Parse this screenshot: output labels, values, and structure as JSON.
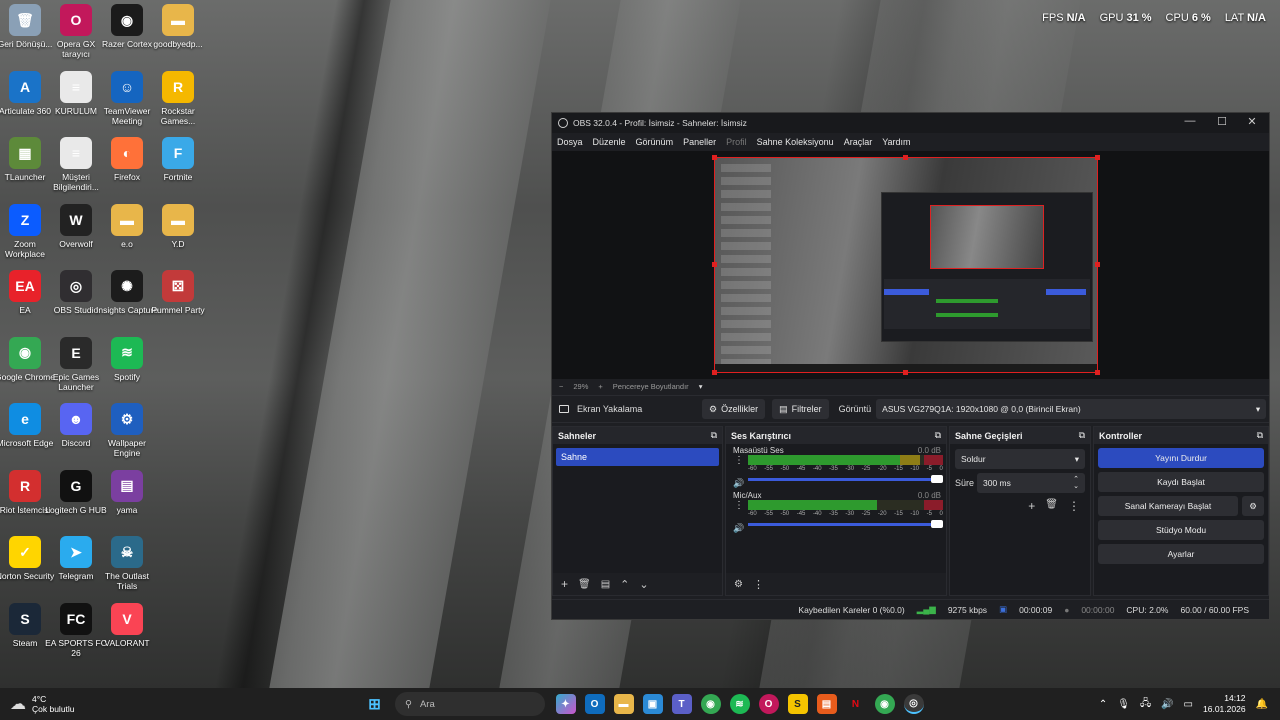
{
  "perf": {
    "fps_label": "FPS",
    "fps_value": "N/A",
    "gpu_label": "GPU",
    "gpu_value": "31 %",
    "cpu_label": "CPU",
    "cpu_value": "6 %",
    "lat_label": "LAT",
    "lat_value": "N/A"
  },
  "desktop_icons": [
    {
      "label": "Geri Dönüşü...",
      "color": "#8aa0b6",
      "glyph": "🗑"
    },
    {
      "label": "Opera GX tarayıcı",
      "color": "#c2185b",
      "glyph": "O"
    },
    {
      "label": "Razer Cortex",
      "color": "#1b1b1b",
      "glyph": "◉"
    },
    {
      "label": "goodbyedp...",
      "color": "#e8b64a",
      "glyph": "▬"
    },
    {
      "label": "Articulate 360",
      "color": "#1a73c8",
      "glyph": "A"
    },
    {
      "label": "KURULUM",
      "color": "#e9e9e9",
      "glyph": "≡"
    },
    {
      "label": "TeamViewer Meeting",
      "color": "#1565c0",
      "glyph": "☺"
    },
    {
      "label": "Rockstar Games...",
      "color": "#f5b800",
      "glyph": "R"
    },
    {
      "label": "TLauncher",
      "color": "#5d8a3a",
      "glyph": "▦"
    },
    {
      "label": "Müşteri Bilgilendiri...",
      "color": "#e9e9e9",
      "glyph": "≡"
    },
    {
      "label": "Firefox",
      "color": "#ff7139",
      "glyph": "◐"
    },
    {
      "label": "Fortnite",
      "color": "#3aa9e8",
      "glyph": "F"
    },
    {
      "label": "Zoom Workplace",
      "color": "#0b5cff",
      "glyph": "Z"
    },
    {
      "label": "Overwolf",
      "color": "#222222",
      "glyph": "W"
    },
    {
      "label": "e.o",
      "color": "#e8b64a",
      "glyph": "▬"
    },
    {
      "label": "Y.D",
      "color": "#e8b64a",
      "glyph": "▬"
    },
    {
      "label": "EA",
      "color": "#e8222a",
      "glyph": "EA"
    },
    {
      "label": "OBS Studio",
      "color": "#302e31",
      "glyph": "◎"
    },
    {
      "label": "Insights Capture",
      "color": "#1c1c1c",
      "glyph": "✺"
    },
    {
      "label": "Pummel Party",
      "color": "#c23a3a",
      "glyph": "⚄"
    },
    {
      "label": "Google Chrome",
      "color": "#34a853",
      "glyph": "◉"
    },
    {
      "label": "Epic Games Launcher",
      "color": "#2a2a2a",
      "glyph": "E"
    },
    {
      "label": "Spotify",
      "color": "#1db954",
      "glyph": "≋"
    },
    {
      "label": "",
      "color": "transparent",
      "glyph": ""
    },
    {
      "label": "Microsoft Edge",
      "color": "#0f8de2",
      "glyph": "e"
    },
    {
      "label": "Discord",
      "color": "#5865f2",
      "glyph": "☻"
    },
    {
      "label": "Wallpaper Engine",
      "color": "#1f5fbf",
      "glyph": "⚙"
    },
    {
      "label": "",
      "color": "transparent",
      "glyph": ""
    },
    {
      "label": "Riot İstemcisi",
      "color": "#d32f2f",
      "glyph": "R"
    },
    {
      "label": "Logitech G HUB",
      "color": "#111111",
      "glyph": "G"
    },
    {
      "label": "yama",
      "color": "#7b3fa0",
      "glyph": "▤"
    },
    {
      "label": "",
      "color": "transparent",
      "glyph": ""
    },
    {
      "label": "Norton Security",
      "color": "#ffd500",
      "glyph": "✓"
    },
    {
      "label": "Telegram",
      "color": "#2aabee",
      "glyph": "➤"
    },
    {
      "label": "The Outlast Trials",
      "color": "#2b6a8a",
      "glyph": "☠"
    },
    {
      "label": "",
      "color": "transparent",
      "glyph": ""
    },
    {
      "label": "Steam",
      "color": "#1b2838",
      "glyph": "S"
    },
    {
      "label": "EA SPORTS FC 26",
      "color": "#111111",
      "glyph": "FC"
    },
    {
      "label": "VALORANT",
      "color": "#fa4454",
      "glyph": "V"
    },
    {
      "label": "",
      "color": "transparent",
      "glyph": ""
    }
  ],
  "obs": {
    "window_title": "OBS 32.0.4 - Profil: İsimsiz - Sahneler: İsimsiz",
    "menu": [
      "Dosya",
      "Düzenle",
      "Görünüm",
      "Paneller",
      "Profil",
      "Sahne Koleksiyonu",
      "Araçlar",
      "Yardım"
    ],
    "zoom": {
      "minus": "−",
      "value": "29%",
      "plus": "+",
      "fit": "Pencereye Boyutlandır"
    },
    "source_bar": {
      "source_name": "Ekran Yakalama",
      "properties": "Özellikler",
      "filters": "Filtreler",
      "display_label": "Görüntü",
      "display_value": "ASUS VG279Q1A: 1920x1080 @ 0,0 (Birincil Ekran)"
    },
    "scenes": {
      "title": "Sahneler",
      "items": [
        "Sahne"
      ]
    },
    "mixer": {
      "title": "Ses Karıştırıcı",
      "scale": [
        "-60",
        "-55",
        "-50",
        "-45",
        "-40",
        "-35",
        "-30",
        "-25",
        "-20",
        "-15",
        "-10",
        "-5",
        "0"
      ],
      "channels": [
        {
          "name": "Masaüstü Ses",
          "db": "0.0 dB",
          "level": 0.88
        },
        {
          "name": "Mic/Aux",
          "db": "0.0 dB",
          "level": 0.66
        }
      ]
    },
    "transitions": {
      "title": "Sahne Geçişleri",
      "type": "Soldur",
      "duration_label": "Süre",
      "duration_value": "300 ms"
    },
    "controls": {
      "title": "Kontroller",
      "buttons": [
        "Yayını Durdur",
        "Kaydı Başlat",
        "Sanal Kamerayı Başlat",
        "Stüdyo Modu",
        "Ayarlar"
      ]
    },
    "status": {
      "dropped": "Kaybedilen Kareler 0 (%0.0)",
      "bitrate": "9275 kbps",
      "stream_time": "00:00:09",
      "rec_time": "00:00:00",
      "cpu": "CPU: 2.0%",
      "fps": "60.00 / 60.00 FPS"
    }
  },
  "taskbar": {
    "weather_temp": "4°C",
    "weather_desc": "Çok bulutlu",
    "search_placeholder": "Ara",
    "time": "14:12",
    "date": "16.01.2026"
  }
}
